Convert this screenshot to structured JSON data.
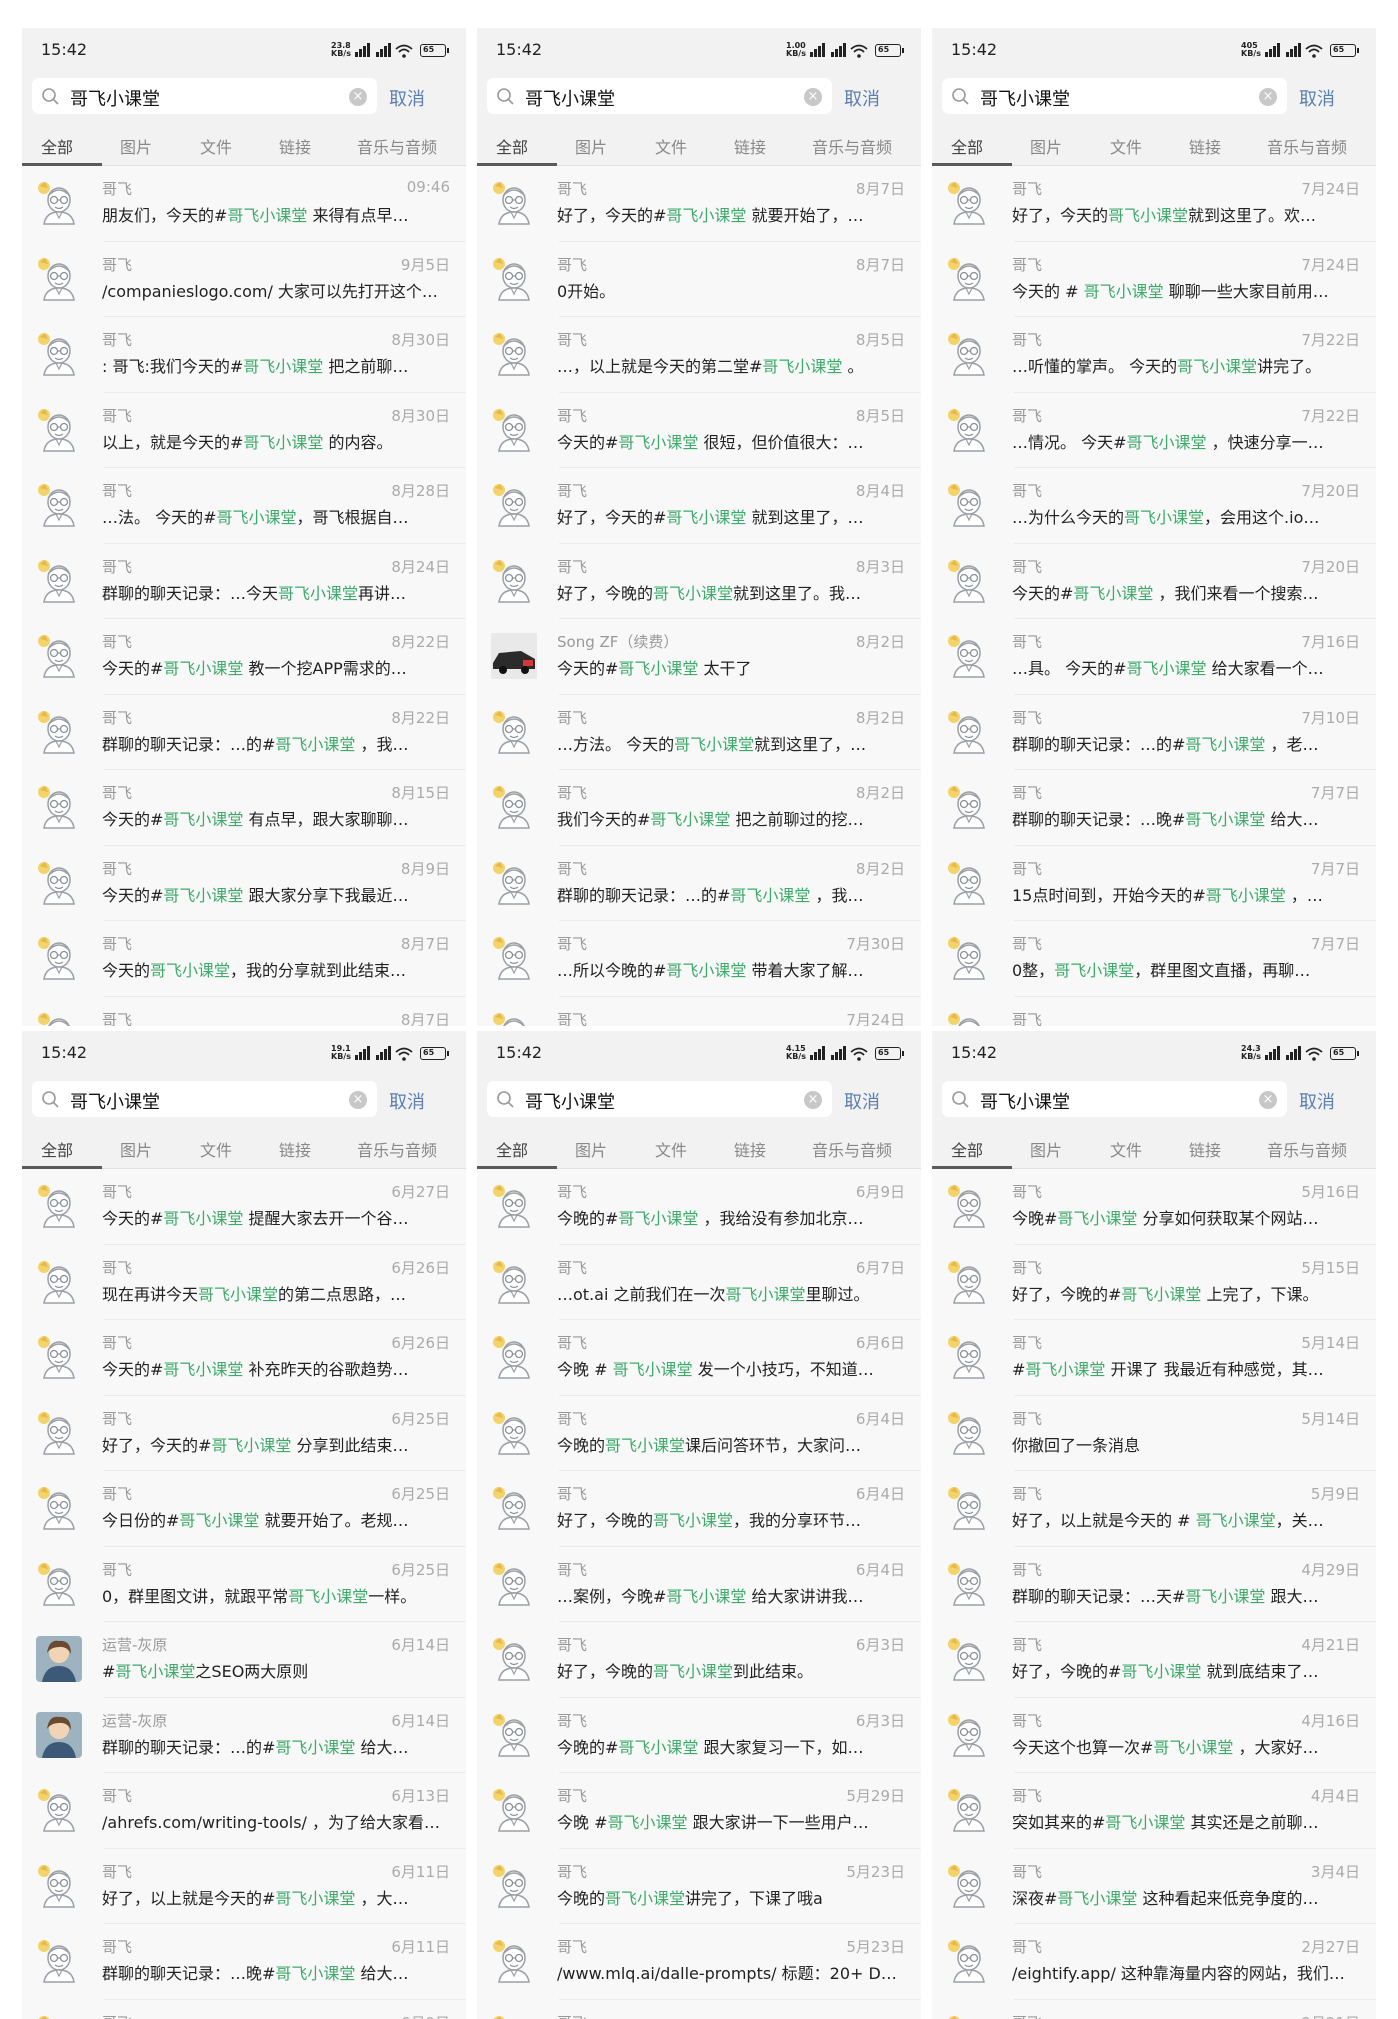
{
  "colors": {
    "highlight": "#3daa6a",
    "cancel": "#5a7fb0"
  },
  "panels": [
    {
      "status": {
        "time": "15:42",
        "net": "23.8 KB/s",
        "battery": "65"
      },
      "search": {
        "query": "哥飞小课堂",
        "cancel": "取消"
      },
      "tabs": [
        "全部",
        "图片",
        "文件",
        "链接",
        "音乐与音频"
      ],
      "items": [
        {
          "avatar": "cartoon-man",
          "name": "哥飞",
          "date": "09:46",
          "message": "朋友们，今天的#哥飞小课堂 来得有点早…"
        },
        {
          "avatar": "cartoon-man",
          "name": "哥飞",
          "date": "9月5日",
          "message": "/companieslogo.com/ 大家可以先打开这个…"
        },
        {
          "avatar": "cartoon-man",
          "name": "哥飞",
          "date": "8月30日",
          "message": ": 哥飞:我们今天的#哥飞小课堂 把之前聊…"
        },
        {
          "avatar": "cartoon-man",
          "name": "哥飞",
          "date": "8月30日",
          "message": "以上，就是今天的#哥飞小课堂 的内容。"
        },
        {
          "avatar": "cartoon-man",
          "name": "哥飞",
          "date": "8月28日",
          "message": "…法。 今天的#哥飞小课堂，哥飞根据自…"
        },
        {
          "avatar": "cartoon-man",
          "name": "哥飞",
          "date": "8月24日",
          "message": "群聊的聊天记录：…今天哥飞小课堂再讲…"
        },
        {
          "avatar": "cartoon-man",
          "name": "哥飞",
          "date": "8月22日",
          "message": "今天的#哥飞小课堂 教一个挖APP需求的…"
        },
        {
          "avatar": "cartoon-man",
          "name": "哥飞",
          "date": "8月22日",
          "message": "群聊的聊天记录：…的#哥飞小课堂 ，我…"
        },
        {
          "avatar": "cartoon-man",
          "name": "哥飞",
          "date": "8月15日",
          "message": "今天的#哥飞小课堂 有点早，跟大家聊聊…"
        },
        {
          "avatar": "cartoon-man",
          "name": "哥飞",
          "date": "8月9日",
          "message": "今天的#哥飞小课堂 跟大家分享下我最近…"
        },
        {
          "avatar": "cartoon-man",
          "name": "哥飞",
          "date": "8月7日",
          "message": "今天的哥飞小课堂，我的分享就到此结束…"
        },
        {
          "avatar": "cartoon-man",
          "name": "哥飞",
          "date": "8月7日",
          "message": "",
          "cut": true
        }
      ]
    },
    {
      "status": {
        "time": "15:42",
        "net": "1.00 KB/s",
        "battery": "65"
      },
      "search": {
        "query": "哥飞小课堂",
        "cancel": "取消"
      },
      "tabs": [
        "全部",
        "图片",
        "文件",
        "链接",
        "音乐与音频"
      ],
      "items": [
        {
          "avatar": "cartoon-man",
          "name": "哥飞",
          "date": "8月7日",
          "message": "好了，今天的#哥飞小课堂 就要开始了，…"
        },
        {
          "avatar": "cartoon-man",
          "name": "哥飞",
          "date": "8月7日",
          "message": "0开始。"
        },
        {
          "avatar": "cartoon-man",
          "name": "哥飞",
          "date": "8月5日",
          "message": "…，以上就是今天的第二堂#哥飞小课堂 。"
        },
        {
          "avatar": "cartoon-man",
          "name": "哥飞",
          "date": "8月5日",
          "message": "今天的#哥飞小课堂 很短，但价值很大：…"
        },
        {
          "avatar": "cartoon-man",
          "name": "哥飞",
          "date": "8月4日",
          "message": "好了，今天的#哥飞小课堂 就到这里了，…"
        },
        {
          "avatar": "cartoon-man",
          "name": "哥飞",
          "date": "8月3日",
          "message": "好了，今晚的哥飞小课堂就到这里了。我…"
        },
        {
          "avatar": "photo-car",
          "name": "Song ZF（续费）",
          "date": "8月2日",
          "message": "今天的#哥飞小课堂 太干了"
        },
        {
          "avatar": "cartoon-man",
          "name": "哥飞",
          "date": "8月2日",
          "message": "…方法。 今天的哥飞小课堂就到这里了，…"
        },
        {
          "avatar": "cartoon-man",
          "name": "哥飞",
          "date": "8月2日",
          "message": "我们今天的#哥飞小课堂 把之前聊过的挖…"
        },
        {
          "avatar": "cartoon-man",
          "name": "哥飞",
          "date": "8月2日",
          "message": "群聊的聊天记录：…的#哥飞小课堂 ，我…"
        },
        {
          "avatar": "cartoon-man",
          "name": "哥飞",
          "date": "7月30日",
          "message": "…所以今晚的#哥飞小课堂 带着大家了解…"
        },
        {
          "avatar": "cartoon-man",
          "name": "哥飞",
          "date": "7月24日",
          "message": "",
          "cut": true
        }
      ]
    },
    {
      "status": {
        "time": "15:42",
        "net": "405 KB/s",
        "battery": "65"
      },
      "search": {
        "query": "哥飞小课堂",
        "cancel": "取消"
      },
      "tabs": [
        "全部",
        "图片",
        "文件",
        "链接",
        "音乐与音频"
      ],
      "items": [
        {
          "avatar": "cartoon-man",
          "name": "哥飞",
          "date": "7月24日",
          "message": "好了，今天的哥飞小课堂就到这里了。欢…"
        },
        {
          "avatar": "cartoon-man",
          "name": "哥飞",
          "date": "7月24日",
          "message": "今天的 # 哥飞小课堂 聊聊一些大家目前用…"
        },
        {
          "avatar": "cartoon-man",
          "name": "哥飞",
          "date": "7月22日",
          "message": "…听懂的掌声。 今天的哥飞小课堂讲完了。"
        },
        {
          "avatar": "cartoon-man",
          "name": "哥飞",
          "date": "7月22日",
          "message": "…情况。 今天#哥飞小课堂 ，快速分享一…"
        },
        {
          "avatar": "cartoon-man",
          "name": "哥飞",
          "date": "7月20日",
          "message": "…为什么今天的哥飞小课堂，会用这个.io…"
        },
        {
          "avatar": "cartoon-man",
          "name": "哥飞",
          "date": "7月20日",
          "message": "今天的#哥飞小课堂 ，我们来看一个搜索…"
        },
        {
          "avatar": "cartoon-man",
          "name": "哥飞",
          "date": "7月16日",
          "message": "…具。 今天的#哥飞小课堂 给大家看一个…"
        },
        {
          "avatar": "cartoon-man",
          "name": "哥飞",
          "date": "7月10日",
          "message": "群聊的聊天记录：…的#哥飞小课堂 ，老…"
        },
        {
          "avatar": "cartoon-man",
          "name": "哥飞",
          "date": "7月7日",
          "message": "群聊的聊天记录：…晚#哥飞小课堂 给大…"
        },
        {
          "avatar": "cartoon-man",
          "name": "哥飞",
          "date": "7月7日",
          "message": "15点时间到，开始今天的#哥飞小课堂 ，…"
        },
        {
          "avatar": "cartoon-man",
          "name": "哥飞",
          "date": "7月7日",
          "message": "0整，哥飞小课堂，群里图文直播，再聊…"
        },
        {
          "avatar": "cartoon-man",
          "name": "哥飞",
          "date": "",
          "message": "",
          "cut": true
        }
      ]
    },
    {
      "status": {
        "time": "15:42",
        "net": "19.1 KB/s",
        "battery": "65"
      },
      "search": {
        "query": "哥飞小课堂",
        "cancel": "取消"
      },
      "tabs": [
        "全部",
        "图片",
        "文件",
        "链接",
        "音乐与音频"
      ],
      "items": [
        {
          "avatar": "cartoon-man",
          "name": "哥飞",
          "date": "6月27日",
          "message": "今天的#哥飞小课堂 提醒大家去开一个谷…"
        },
        {
          "avatar": "cartoon-man",
          "name": "哥飞",
          "date": "6月26日",
          "message": "现在再讲今天哥飞小课堂的第二点思路，…"
        },
        {
          "avatar": "cartoon-man",
          "name": "哥飞",
          "date": "6月26日",
          "message": "今天的#哥飞小课堂 补充昨天的谷歌趋势…"
        },
        {
          "avatar": "cartoon-man",
          "name": "哥飞",
          "date": "6月25日",
          "message": "好了，今天的#哥飞小课堂 分享到此结束…"
        },
        {
          "avatar": "cartoon-man",
          "name": "哥飞",
          "date": "6月25日",
          "message": "今日份的#哥飞小课堂 就要开始了。老规…"
        },
        {
          "avatar": "cartoon-man",
          "name": "哥飞",
          "date": "6月25日",
          "message": "0，群里图文讲，就跟平常哥飞小课堂一样。"
        },
        {
          "avatar": "photo-person",
          "name": "运营-灰原",
          "date": "6月14日",
          "message": "#哥飞小课堂之SEO两大原则"
        },
        {
          "avatar": "photo-person",
          "name": "运营-灰原",
          "date": "6月14日",
          "message": "群聊的聊天记录：…的#哥飞小课堂 给大…"
        },
        {
          "avatar": "cartoon-man",
          "name": "哥飞",
          "date": "6月13日",
          "message": "/ahrefs.com/writing-tools/ ，为了给大家看…"
        },
        {
          "avatar": "cartoon-man",
          "name": "哥飞",
          "date": "6月11日",
          "message": "好了，以上就是今天的#哥飞小课堂 ，大…"
        },
        {
          "avatar": "cartoon-man",
          "name": "哥飞",
          "date": "6月11日",
          "message": "群聊的聊天记录：…晚#哥飞小课堂 给大…"
        },
        {
          "avatar": "cartoon-man",
          "name": "哥飞",
          "date": "6月9日",
          "message": "",
          "cut": true
        }
      ]
    },
    {
      "status": {
        "time": "15:42",
        "net": "4.15 KB/s",
        "battery": "65"
      },
      "search": {
        "query": "哥飞小课堂",
        "cancel": "取消"
      },
      "tabs": [
        "全部",
        "图片",
        "文件",
        "链接",
        "音乐与音频"
      ],
      "items": [
        {
          "avatar": "cartoon-man",
          "name": "哥飞",
          "date": "6月9日",
          "message": "今晚的#哥飞小课堂 ，我给没有参加北京…"
        },
        {
          "avatar": "cartoon-man",
          "name": "哥飞",
          "date": "6月7日",
          "message": "…ot.ai 之前我们在一次哥飞小课堂里聊过。"
        },
        {
          "avatar": "cartoon-man",
          "name": "哥飞",
          "date": "6月6日",
          "message": "今晚 # 哥飞小课堂 发一个小技巧，不知道…"
        },
        {
          "avatar": "cartoon-man",
          "name": "哥飞",
          "date": "6月4日",
          "message": "今晚的哥飞小课堂课后问答环节，大家问…"
        },
        {
          "avatar": "cartoon-man",
          "name": "哥飞",
          "date": "6月4日",
          "message": "好了，今晚的哥飞小课堂，我的分享环节…"
        },
        {
          "avatar": "cartoon-man",
          "name": "哥飞",
          "date": "6月4日",
          "message": "…案例，今晚#哥飞小课堂 给大家讲讲我…"
        },
        {
          "avatar": "cartoon-man",
          "name": "哥飞",
          "date": "6月3日",
          "message": "好了，今晚的哥飞小课堂到此结束。"
        },
        {
          "avatar": "cartoon-man",
          "name": "哥飞",
          "date": "6月3日",
          "message": "今晚的#哥飞小课堂 跟大家复习一下，如…"
        },
        {
          "avatar": "cartoon-man",
          "name": "哥飞",
          "date": "5月29日",
          "message": "今晚 #哥飞小课堂 跟大家讲一下一些用户…"
        },
        {
          "avatar": "cartoon-man",
          "name": "哥飞",
          "date": "5月23日",
          "message": "今晚的哥飞小课堂讲完了，下课了哦a"
        },
        {
          "avatar": "cartoon-man",
          "name": "哥飞",
          "date": "5月23日",
          "message": "/www.mlq.ai/dalle-prompts/ 标题：20+ D…"
        },
        {
          "avatar": "cartoon-man",
          "name": "哥飞",
          "date": "",
          "message": "",
          "cut": true
        }
      ]
    },
    {
      "status": {
        "time": "15:42",
        "net": "24.3 KB/s",
        "battery": "65"
      },
      "search": {
        "query": "哥飞小课堂",
        "cancel": "取消"
      },
      "tabs": [
        "全部",
        "图片",
        "文件",
        "链接",
        "音乐与音频"
      ],
      "items": [
        {
          "avatar": "cartoon-man",
          "name": "哥飞",
          "date": "5月16日",
          "message": "今晚#哥飞小课堂 分享如何获取某个网站…"
        },
        {
          "avatar": "cartoon-man",
          "name": "哥飞",
          "date": "5月15日",
          "message": "好了，今晚的#哥飞小课堂 上完了，下课。"
        },
        {
          "avatar": "cartoon-man",
          "name": "哥飞",
          "date": "5月14日",
          "message": "#哥飞小课堂 开课了 我最近有种感觉，其…"
        },
        {
          "avatar": "cartoon-man",
          "name": "哥飞",
          "date": "5月14日",
          "message": "你撤回了一条消息"
        },
        {
          "avatar": "cartoon-man",
          "name": "哥飞",
          "date": "5月9日",
          "message": "好了，以上就是今天的 # 哥飞小课堂，关…"
        },
        {
          "avatar": "cartoon-man",
          "name": "哥飞",
          "date": "4月29日",
          "message": "群聊的聊天记录：…天#哥飞小课堂 跟大…"
        },
        {
          "avatar": "cartoon-man",
          "name": "哥飞",
          "date": "4月21日",
          "message": "好了，今晚的#哥飞小课堂 就到底结束了…"
        },
        {
          "avatar": "cartoon-man",
          "name": "哥飞",
          "date": "4月16日",
          "message": "今天这个也算一次#哥飞小课堂 ，大家好…"
        },
        {
          "avatar": "cartoon-man",
          "name": "哥飞",
          "date": "4月4日",
          "message": "突如其来的#哥飞小课堂 其实还是之前聊…"
        },
        {
          "avatar": "cartoon-man",
          "name": "哥飞",
          "date": "3月4日",
          "message": "深夜#哥飞小课堂 这种看起来低竞争度的…"
        },
        {
          "avatar": "cartoon-man",
          "name": "哥飞",
          "date": "2月27日",
          "message": "/eightify.app/ 这种靠海量内容的网站，我们…"
        },
        {
          "avatar": "cartoon-man",
          "name": "哥飞",
          "date": "2月21日",
          "message": "",
          "cut": true
        }
      ]
    }
  ]
}
